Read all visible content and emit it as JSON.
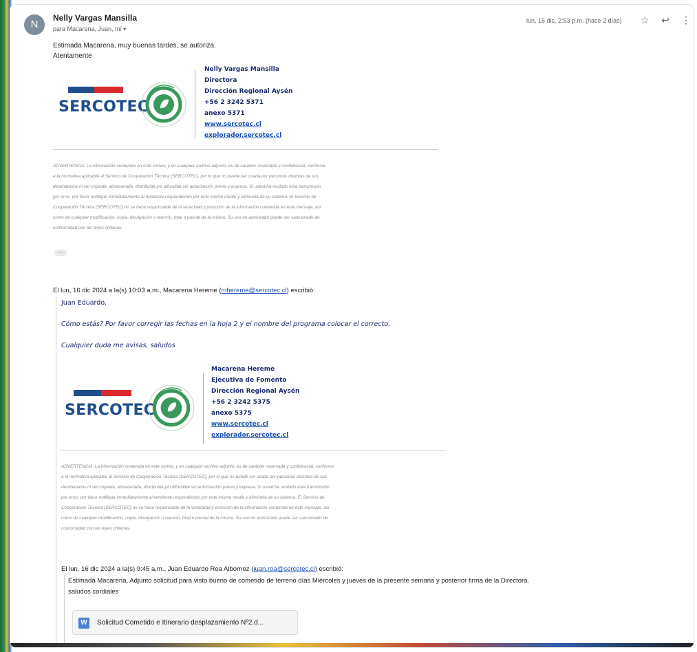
{
  "header": {
    "avatar_letter": "N",
    "sender_name": "Nelly Vargas Mansilla",
    "recipients": "para Macarena, Juan, mí",
    "date": "lun, 16 dic, 2:53 p.m. (hace 2 días)",
    "icons": [
      "star-icon",
      "reply-icon",
      "more-vert-icon"
    ]
  },
  "message": {
    "line1": "Estimada Macarena, muy buenas tardes,  se autoriza.",
    "line2": "Atentamente"
  },
  "signature1": {
    "logo_text": "SERCOTEC",
    "lines": [
      "Nelly Vargas Mansilla",
      "Directora",
      "Dirección Regional Aysén",
      "+56 2 3242 5371",
      "anexo 5371"
    ],
    "link1": "www.sercotec.cl",
    "link2": "explorador.sercotec.cl"
  },
  "disclaimer": {
    "lines": [
      "ADVERTENCIA: La información contenida en este correo, y en cualquier archivo adjunto, es de carácter reservada y confidencial, conforme",
      "a la normativa aplicable al Servicio de Cooperación Técnica (SERCOTEC), por lo que no puede ser usada por personas distintas de sus",
      "destinatarios ni ser copiada, almacenada, distribuida y/o difundida sin autorización previa y expresa. Si usted ha recibido esta transmisión",
      "por error, por favor notifique inmediatamente al remitente respondiendo por este mismo medio y elimínela de su sistema. El Servicio de",
      "Cooperación Técnica (SERCOTEC) no se hace responsable de la veracidad y precisión de la información contenida en este mensaje, así",
      "como de cualquier modificación, copia, divulgación o reenvío, total o parcial de la misma. Su uso no autorizado puede ser sancionado de",
      "conformidad con las leyes chilenas."
    ]
  },
  "quote1": {
    "header_prefix": "El lun, 16 dic 2024 a la(s) 10:03 a.m., Macarena Hereme (",
    "email": "mhereme@sercotec.cl",
    "header_suffix": ") escribió:",
    "greeting": "Juan Eduardo,",
    "body1": "Cómo estás? Por favor corregir las fechas en la hoja 2 y el nombre del programa colocar el correcto.",
    "body2": "Cualquier duda me avisas, saludos"
  },
  "signature2": {
    "logo_text": "SERCOTEC",
    "lines": [
      "Macarena Hereme",
      "Ejecutiva de Fomento",
      "Dirección Regional Aysén",
      "+56 2 3242 5375",
      "anexo 5375"
    ],
    "link1": "www.sercotec.cl",
    "link2": "explorador.sercotec.cl"
  },
  "quote2": {
    "header_prefix": "El lun, 16 dic 2024 a la(s) 9:45 a.m., Juan Eduardo Roa Albornoz (",
    "email": "juan.roa@sercotec.cl",
    "header_suffix": ") escribió:",
    "body1": "Estimada Macarena, Adjunto solicitud para visto bueno de cometido de terreno días Miércoles y jueves de la presente semana y posterior firma de la Directora.",
    "body2": "saludos cordiales"
  },
  "attachment": {
    "icon_letter": "W",
    "name": "Solicitud Cometido e Itinerario desplazamiento Nº2.d..."
  },
  "colors": {
    "sercotec_blue": "#1f4e8c",
    "sercotec_red": "#d92b2b",
    "seal_green": "#3a9a5b",
    "signature_text": "#1a2b6d",
    "link": "#1a4fb5"
  }
}
